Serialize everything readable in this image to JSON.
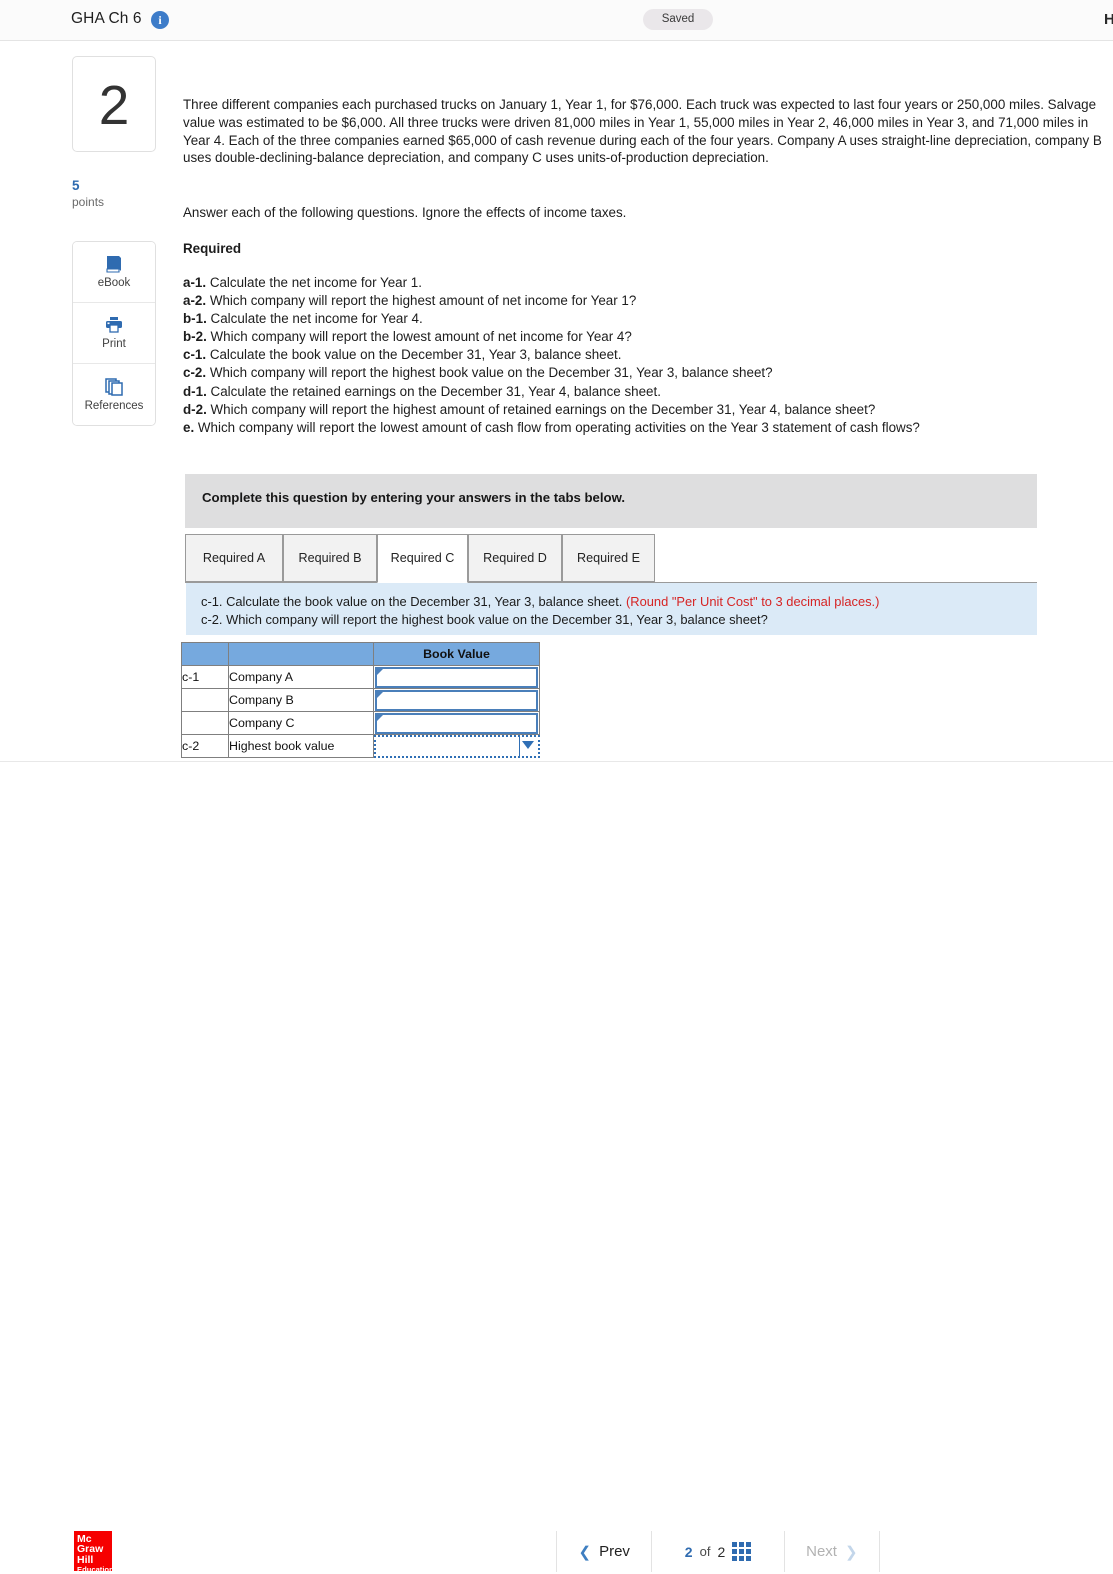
{
  "topbar": {
    "assignment_title": "GHA Ch 6",
    "info_icon": "info-icon",
    "saved_label": "Saved",
    "help_label": "H"
  },
  "left_rail": {
    "question_number": "2",
    "points_value": "5",
    "points_label": "points",
    "tools": [
      {
        "icon": "ebook-icon",
        "label": "eBook"
      },
      {
        "icon": "printer-icon",
        "label": "Print"
      },
      {
        "icon": "references-icon",
        "label": "References"
      }
    ]
  },
  "question": {
    "body": "Three different companies each purchased trucks on January 1, Year 1, for $76,000. Each truck was expected to last four years or 250,000 miles. Salvage value was estimated to be $6,000. All three trucks were driven 81,000 miles in Year 1, 55,000 miles in Year 2, 46,000 miles in Year 3, and 71,000 miles in Year 4. Each of the three companies earned $65,000 of cash revenue during each of the four years. Company A uses straight-line depreciation, company B uses double-declining-balance depreciation, and company C uses units-of-production depreciation.",
    "answer_note": "Answer each of the following questions. Ignore the effects of income taxes.",
    "required_heading": "Required",
    "required_items": [
      {
        "key": "a-1.",
        "text": "Calculate the net income for Year 1."
      },
      {
        "key": "a-2.",
        "text": "Which company will report the highest amount of net income for Year 1?"
      },
      {
        "key": "b-1.",
        "text": "Calculate the net income for Year 4."
      },
      {
        "key": "b-2.",
        "text": "Which company will report the lowest amount of net income for Year 4?"
      },
      {
        "key": "c-1.",
        "text": "Calculate the book value on the December 31, Year 3, balance sheet."
      },
      {
        "key": "c-2.",
        "text": "Which company will report the highest book value on the December 31, Year 3, balance sheet?"
      },
      {
        "key": "d-1.",
        "text": "Calculate the retained earnings on the December 31, Year 4, balance sheet."
      },
      {
        "key": "d-2.",
        "text": "Which company will report the highest amount of retained earnings on the December 31, Year 4, balance sheet?"
      },
      {
        "key": "e.",
        "text": "Which company will report the lowest amount of cash flow from operating activities on the Year 3 statement of cash flows?"
      }
    ]
  },
  "instruction_banner": {
    "text": "Complete this question by entering your answers in the tabs below."
  },
  "tabs": {
    "active_index": 2,
    "items": [
      {
        "label": "Required A"
      },
      {
        "label": "Required B"
      },
      {
        "label": "Required C"
      },
      {
        "label": "Required D"
      },
      {
        "label": "Required E"
      }
    ]
  },
  "prompt": {
    "line1_main": "c-1. Calculate the book value on the December 31, Year 3, balance sheet.",
    "line1_note": "(Round \"Per Unit Cost\" to 3 decimal places.)",
    "line2": "c-2. Which company will report the highest book value on the December 31, Year 3, balance sheet?"
  },
  "answer_table": {
    "header": {
      "col1": "",
      "col2": "",
      "col3": "Book Value"
    },
    "rows": [
      {
        "code": "c-1",
        "label": "Company A",
        "value": "",
        "type": "input"
      },
      {
        "code": "",
        "label": "Company B",
        "value": "",
        "type": "input"
      },
      {
        "code": "",
        "label": "Company C",
        "value": "",
        "type": "input"
      },
      {
        "code": "c-2",
        "label": "Highest book value",
        "value": "",
        "type": "select"
      }
    ]
  },
  "footer": {
    "logo": {
      "line1": "Mc",
      "line2": "Graw",
      "line3": "Hill",
      "line4": "Education"
    },
    "prev_label": "Prev",
    "next_label": "Next",
    "page_current": "2",
    "page_of": "of",
    "page_total": "2",
    "grid_icon": "grid-icon"
  },
  "colors": {
    "accent_blue": "#2f6bb0",
    "table_header_blue": "#76a9de",
    "prompt_bg": "#dbeaf7",
    "banner_gray": "#dededf",
    "round_note_red": "#d62424",
    "logo_red": "#f60000"
  }
}
